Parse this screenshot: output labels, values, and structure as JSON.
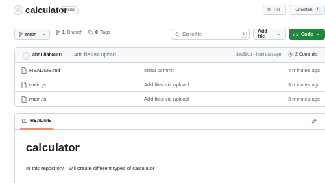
{
  "repo": {
    "name": "calculator",
    "visibility": "Public",
    "pin_label": "Pin",
    "unwatch_label": "Unwatch",
    "watch_count": "1"
  },
  "toolbar": {
    "branch": "main",
    "branches_count": "1",
    "branches_label": "Branch",
    "tags_count": "0",
    "tags_label": "Tags",
    "goto_placeholder": "Go to file",
    "goto_shortcut": "t",
    "add_file_label": "Add file",
    "code_label": "Code"
  },
  "latest_commit": {
    "author": "abdullahN111",
    "message": "Add files via upload",
    "meta": "3de69cb · 3 minutes ago",
    "commits_label": "2 Commits"
  },
  "files": [
    {
      "name": "README.md",
      "commit": "Initial commit",
      "time": "4 minutes ago"
    },
    {
      "name": "main.js",
      "commit": "Add files via upload",
      "time": "3 minutes ago"
    },
    {
      "name": "main.ts",
      "commit": "Add files via upload",
      "time": "3 minutes ago"
    }
  ],
  "readme": {
    "tab_label": "README",
    "title": "calculator",
    "body": "In this repository, i will create different types of calculator"
  },
  "colors": {
    "accent_green": "#1f883d",
    "tab_underline": "#fd8c73",
    "border": "#d0d7de",
    "muted_text": "#59636e"
  }
}
